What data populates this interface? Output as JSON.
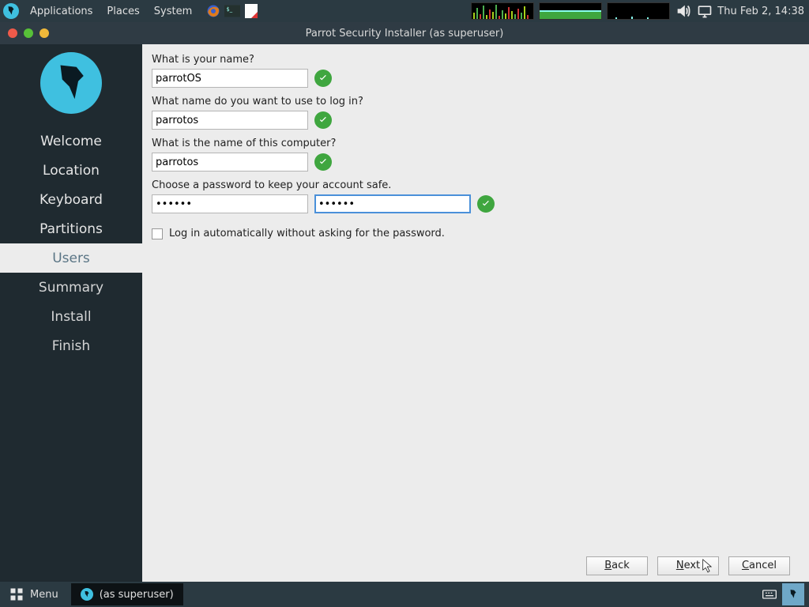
{
  "os_panel": {
    "menus": [
      "Applications",
      "Places",
      "System"
    ],
    "clock": "Thu Feb  2, 14:38"
  },
  "window": {
    "title": "Parrot Security Installer (as superuser)"
  },
  "sidebar": {
    "steps": [
      "Welcome",
      "Location",
      "Keyboard",
      "Partitions",
      "Users",
      "Summary",
      "Install",
      "Finish"
    ],
    "active_index": 4
  },
  "form": {
    "name": {
      "label": "What is your name?",
      "value": "parrotOS"
    },
    "login": {
      "label": "What name do you want to use to log in?",
      "value": "parrotos"
    },
    "host": {
      "label": "What is the name of this computer?",
      "value": "parrotos"
    },
    "password": {
      "label": "Choose a password to keep your account safe.",
      "mask": "••••••",
      "mask2": "••••••"
    },
    "autologin": {
      "label": "Log in automatically without asking for the password.",
      "checked": false
    }
  },
  "footer": {
    "back": "Back",
    "next": "Next",
    "cancel": "Cancel",
    "back_u": "B",
    "next_u": "N",
    "cancel_u": "C",
    "back_rest": "ack",
    "next_rest": "ext",
    "cancel_rest": "ancel"
  },
  "bottom": {
    "menu_label": "Menu",
    "task_label": "(as superuser)"
  }
}
